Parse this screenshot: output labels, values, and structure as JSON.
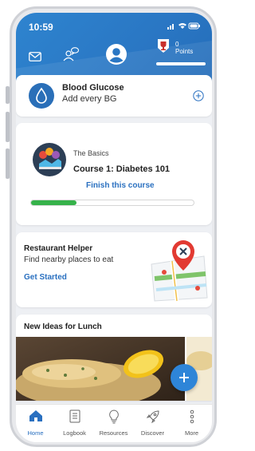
{
  "status_bar": {
    "time": "10:59"
  },
  "header": {
    "points_count": "0",
    "points_label": "Points"
  },
  "blood_glucose": {
    "title": "Blood Glucose",
    "subtitle": "Add every BG"
  },
  "course": {
    "eyebrow": "The Basics",
    "title": "Course 1: Diabetes 101",
    "cta": "Finish this course",
    "progress": 0.28
  },
  "restaurant": {
    "title": "Restaurant Helper",
    "subtitle": "Find nearby places to eat",
    "cta": "Get Started"
  },
  "ideas": {
    "title": "New Ideas for Lunch"
  },
  "tabbar": {
    "items": [
      {
        "label": "Home",
        "icon": "home-icon",
        "active": true
      },
      {
        "label": "Logbook",
        "icon": "logbook-icon",
        "active": false
      },
      {
        "label": "Resources",
        "icon": "lightbulb-icon",
        "active": false
      },
      {
        "label": "Discover",
        "icon": "rocket-icon",
        "active": false
      },
      {
        "label": "More",
        "icon": "more-icon",
        "active": false
      }
    ]
  },
  "colors": {
    "accent": "#2a70c0",
    "progress": "#35b24a",
    "header": "#2a77c4"
  }
}
